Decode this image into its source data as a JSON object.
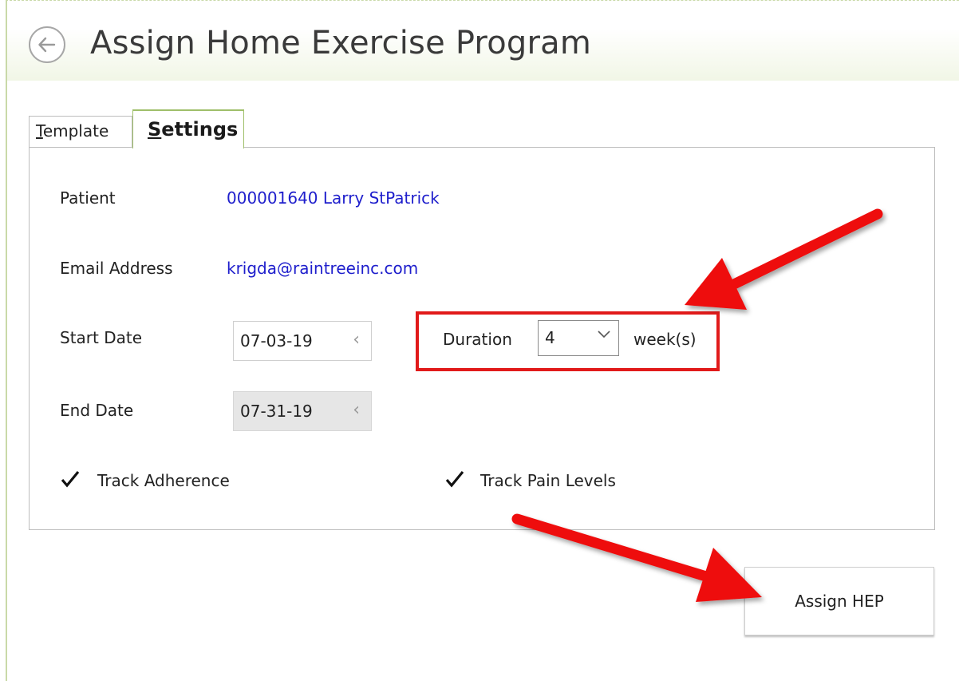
{
  "header": {
    "title": "Assign Home Exercise Program",
    "back_icon": "arrow-left-circle-icon"
  },
  "tabs": [
    {
      "label_underlined": "T",
      "label_rest": "emplate",
      "active": false
    },
    {
      "label_underlined": "S",
      "label_rest": "ettings",
      "active": true
    }
  ],
  "settings": {
    "patient_label": "Patient",
    "patient_value": "000001640 Larry StPatrick",
    "email_label": "Email Address",
    "email_value": "krigda@raintreeinc.com",
    "start_date_label": "Start Date",
    "start_date_value": "07-03-19",
    "end_date_label": "End Date",
    "end_date_value": "07-31-19",
    "duration_label": "Duration",
    "duration_value": "4",
    "duration_unit": "week(s)",
    "track_adherence_label": "Track Adherence",
    "track_adherence_checked": true,
    "track_pain_label": "Track Pain Levels",
    "track_pain_checked": true
  },
  "actions": {
    "assign_label": "Assign HEP"
  },
  "colors": {
    "accent_green": "#9fbf6a",
    "link_blue": "#1e1ecc",
    "annotation_red": "#e11a1a"
  }
}
